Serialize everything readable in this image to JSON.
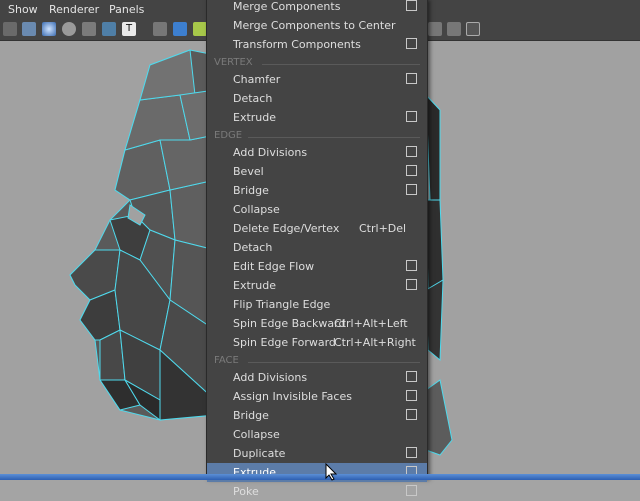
{
  "menubar": {
    "items": [
      "Show",
      "Renderer",
      "Panels"
    ]
  },
  "menu": {
    "rows": [
      {
        "label": "Merge Components",
        "option": true
      },
      {
        "label": "Merge Components to Center",
        "option": false
      },
      {
        "label": "Transform Components",
        "option": true
      },
      {
        "section": "VERTEX"
      },
      {
        "label": "Chamfer",
        "option": true
      },
      {
        "label": "Detach",
        "option": false
      },
      {
        "label": "Extrude",
        "option": true
      },
      {
        "section": "EDGE"
      },
      {
        "label": "Add Divisions",
        "option": true
      },
      {
        "label": "Bevel",
        "option": true
      },
      {
        "label": "Bridge",
        "option": true
      },
      {
        "label": "Collapse",
        "option": false
      },
      {
        "label": "Delete Edge/Vertex",
        "shortcut": "Ctrl+Del",
        "option": false
      },
      {
        "label": "Detach",
        "option": false
      },
      {
        "label": "Edit Edge Flow",
        "option": true
      },
      {
        "label": "Extrude",
        "option": true
      },
      {
        "label": "Flip Triangle Edge",
        "option": false
      },
      {
        "label": "Spin Edge Backward",
        "shortcut": "Ctrl+Alt+Left",
        "option": false
      },
      {
        "label": "Spin Edge Forward",
        "shortcut": "Ctrl+Alt+Right",
        "option": false
      },
      {
        "section": "FACE"
      },
      {
        "label": "Add Divisions",
        "option": true
      },
      {
        "label": "Assign Invisible Faces",
        "option": true
      },
      {
        "label": "Bridge",
        "option": true
      },
      {
        "label": "Collapse",
        "option": false
      },
      {
        "label": "Duplicate",
        "option": true
      },
      {
        "label": "Extrude",
        "option": true,
        "highlighted": true
      },
      {
        "label": "Poke",
        "option": true
      }
    ]
  },
  "colors": {
    "menu_bg": "#444444",
    "highlight": "#5c7ca8",
    "viewport_bg": "#a1a1a1",
    "wire": "#4fd9ec",
    "mesh": "#565656"
  }
}
